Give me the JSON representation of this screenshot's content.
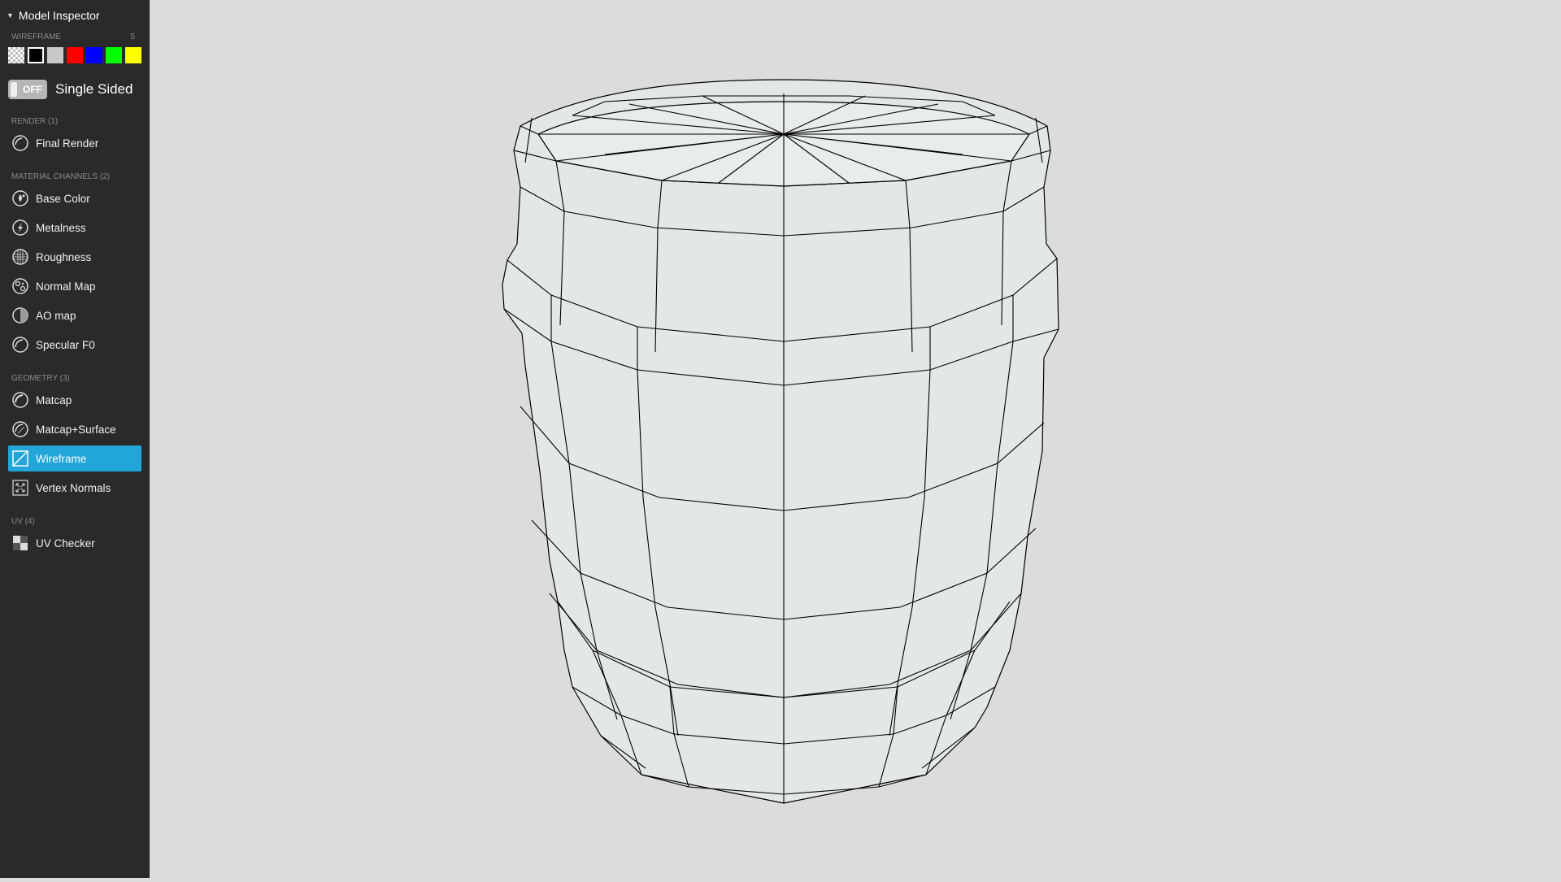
{
  "inspector": {
    "title": "Model Inspector",
    "wireframe": {
      "label": "WIREFRAME",
      "value": "5",
      "colors": [
        {
          "name": "transparent-checker",
          "hex": "checker"
        },
        {
          "name": "black",
          "hex": "#000000"
        },
        {
          "name": "gray",
          "hex": "#c8c8c8"
        },
        {
          "name": "red",
          "hex": "#ff0000"
        },
        {
          "name": "blue",
          "hex": "#0000ff"
        },
        {
          "name": "green",
          "hex": "#00ff00"
        },
        {
          "name": "yellow",
          "hex": "#ffff00"
        }
      ],
      "selected": "black"
    },
    "single_sided": {
      "state": "OFF",
      "label": "Single Sided"
    },
    "groups": [
      {
        "label": "RENDER (1)",
        "items": [
          {
            "label": "Final Render",
            "icon": "final-render-icon"
          }
        ]
      },
      {
        "label": "MATERIAL CHANNELS (2)",
        "items": [
          {
            "label": "Base Color",
            "icon": "base-color-icon"
          },
          {
            "label": "Metalness",
            "icon": "metalness-icon"
          },
          {
            "label": "Roughness",
            "icon": "roughness-icon"
          },
          {
            "label": "Normal Map",
            "icon": "normal-map-icon"
          },
          {
            "label": "AO map",
            "icon": "ao-map-icon"
          },
          {
            "label": "Specular F0",
            "icon": "specular-icon"
          }
        ]
      },
      {
        "label": "GEOMETRY (3)",
        "items": [
          {
            "label": "Matcap",
            "icon": "matcap-icon"
          },
          {
            "label": "Matcap+Surface",
            "icon": "matcap-surface-icon"
          },
          {
            "label": "Wireframe",
            "icon": "wireframe-icon",
            "active": true
          },
          {
            "label": "Vertex Normals",
            "icon": "vertex-normals-icon"
          }
        ]
      },
      {
        "label": "UV (4)",
        "items": [
          {
            "label": "UV Checker",
            "icon": "uv-checker-icon"
          }
        ]
      }
    ]
  },
  "colors": {
    "sidebar_bg": "#2a2a2a",
    "accent": "#22a5d8",
    "viewport_bg": "#dcdcdc",
    "mesh_fill": "#e4e7e7",
    "wire": "#000000"
  }
}
